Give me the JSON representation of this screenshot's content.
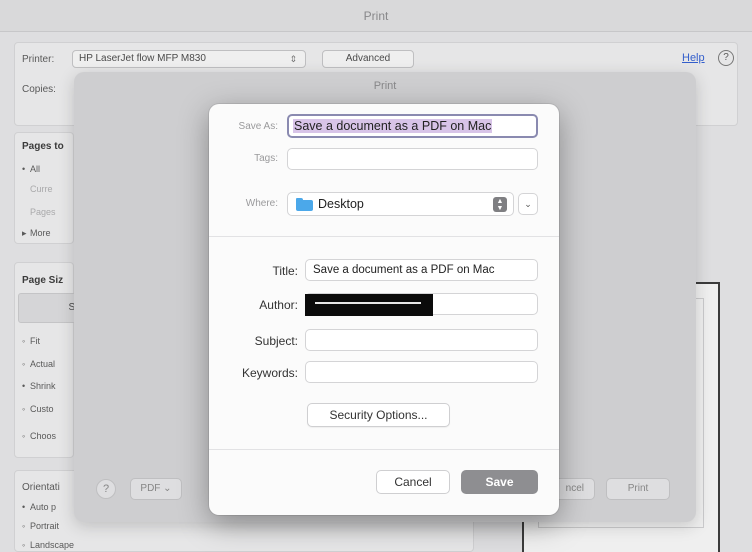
{
  "background_print": {
    "title": "Print",
    "printer_label": "Printer:",
    "printer_value": "HP LaserJet flow MFP M830",
    "advanced_label": "Advanced",
    "copies_label": "Copies:",
    "help_label": "Help",
    "help_icon": "?",
    "pages_heading": "Pages to",
    "pages_items": [
      "All",
      "Curre",
      "Pages",
      "More"
    ],
    "page_size_heading": "Page Siz",
    "size_button": "Si",
    "size_items": [
      "Fit",
      "Actual",
      "Shrink",
      "Custo",
      "Choos"
    ],
    "orientation_heading": "Orientati",
    "orientation_items": [
      "Auto p",
      "Portrait",
      "Landscape"
    ]
  },
  "mac_print_sheet": {
    "title": "Print",
    "help_button": "?",
    "pdf_button": "PDF ⌄",
    "cancel_button": "ncel",
    "print_button": "Print"
  },
  "save_dialog": {
    "save_as_label": "Save As:",
    "save_as_value": "Save a document as a PDF on Mac",
    "tags_label": "Tags:",
    "tags_value": "",
    "where_label": "Where:",
    "where_value": "Desktop",
    "where_icon": "folder-icon",
    "title_label": "Title:",
    "title_value": "Save a document as a PDF on Mac",
    "author_label": "Author:",
    "subject_label": "Subject:",
    "subject_value": "",
    "keywords_label": "Keywords:",
    "keywords_value": "",
    "security_options_label": "Security Options...",
    "cancel_label": "Cancel",
    "save_label": "Save"
  }
}
